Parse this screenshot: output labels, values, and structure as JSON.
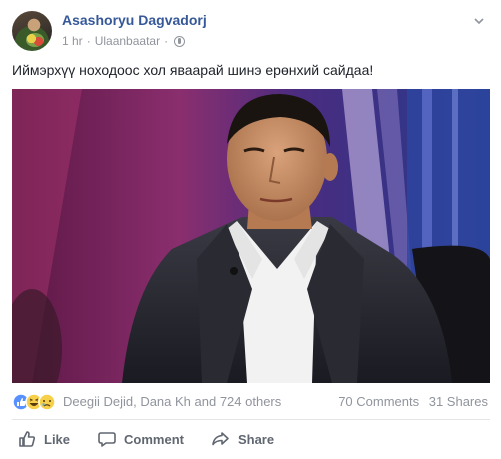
{
  "post": {
    "author": "Asashoryu Dagvadorj",
    "time": "1 hr",
    "separator": "·",
    "location": "Ulaanbaatar",
    "location_separator": "·",
    "text": "Иймэрхүү ноходоос хол яваарай шинэ ерөнхий сайдаа!",
    "photo_alt": "Man in a dark suit and white shirt seated in a TV studio"
  },
  "reactions": {
    "icons": [
      "like-reaction",
      "haha-reaction",
      "sad-reaction"
    ],
    "names": "Deegii Dejid, Dana Kh and 724 others",
    "comments": "70 Comments",
    "shares": "31 Shares"
  },
  "actions": {
    "like": "Like",
    "comment": "Comment",
    "share": "Share"
  },
  "colors": {
    "author": "#365899",
    "secondary_text": "#90949c",
    "action_text": "#606770",
    "like_blue": "#5890ff"
  }
}
